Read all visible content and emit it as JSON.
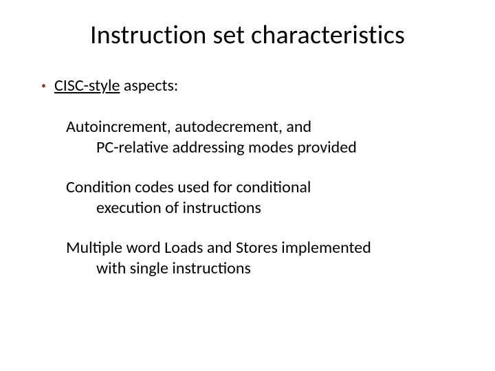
{
  "title": "Instruction set characteristics",
  "bullet": {
    "underlined": "CISC-style",
    "rest": " aspects:"
  },
  "blocks": [
    {
      "first": "Autoincrement, autodecrement, and",
      "cont": "PC-relative addressing modes provided"
    },
    {
      "first": "Condition codes used for conditional",
      "cont": "execution of instructions"
    },
    {
      "first": "Multiple word Loads and Stores implemented",
      "cont": "with single instructions"
    }
  ]
}
